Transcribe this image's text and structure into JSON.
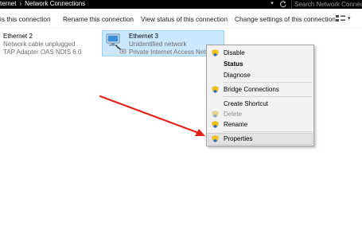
{
  "address_bar": {
    "crumbs": [
      "ternet",
      "Network Connections"
    ],
    "separator": "›",
    "search_placeholder": "Search Network Connecti"
  },
  "commands": {
    "disable": "is this connection",
    "rename": "Rename this connection",
    "view_status": "View status of this connection",
    "change_settings": "Change settings of this connection"
  },
  "connections": [
    {
      "name": "Ethernet 2",
      "status": "Network cable unplugged",
      "adapter": "TAP Adapter OAS NDIS 6.0"
    },
    {
      "name": "Ethernet 3",
      "status": "Unidentified network",
      "adapter": "Private Internet Access Netwo"
    }
  ],
  "context_menu": {
    "items": [
      "Disable",
      "Status",
      "Diagnose",
      "Bridge Connections",
      "Create Shortcut",
      "Delete",
      "Rename",
      "Properties"
    ]
  },
  "colors": {
    "selection_bg": "#cce8ff",
    "selection_border": "#99d1ff",
    "menu_bg": "#f2f2f2",
    "arrow": "#e0241b",
    "shield_blue": "#2f6fc6",
    "shield_yellow": "#f4c20d"
  },
  "icons": [
    "refresh-icon",
    "view-options-icon",
    "network-adapter-icon",
    "uac-shield-icon",
    "red-arrow-annotation"
  ]
}
